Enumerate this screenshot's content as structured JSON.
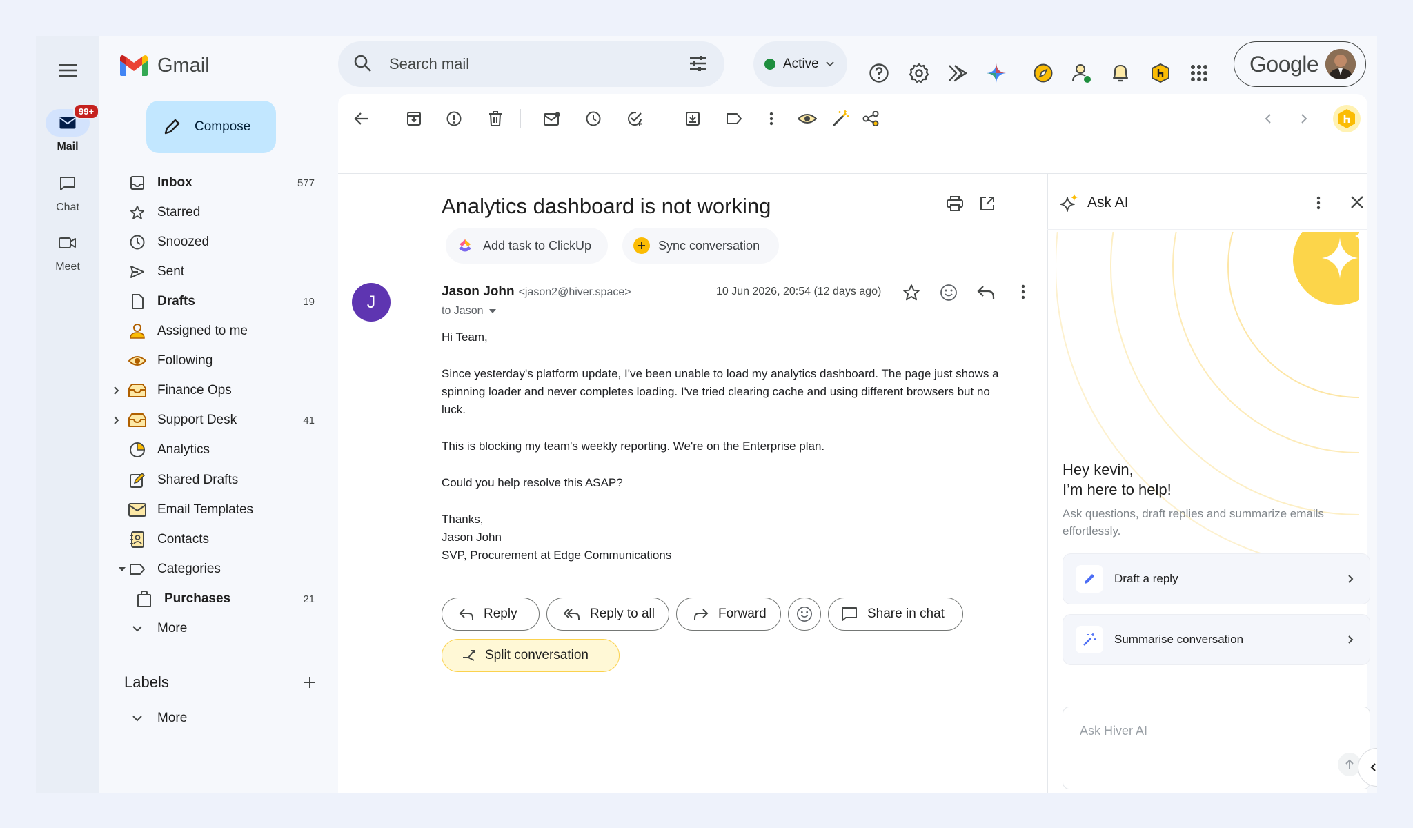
{
  "app": {
    "name": "Gmail"
  },
  "rail": {
    "items": [
      {
        "label": "Mail",
        "badge": "99+"
      },
      {
        "label": "Chat"
      },
      {
        "label": "Meet"
      }
    ]
  },
  "sidebar": {
    "compose_label": "Compose",
    "items": [
      {
        "label": "Inbox",
        "count": "577"
      },
      {
        "label": "Starred",
        "count": ""
      },
      {
        "label": "Snoozed",
        "count": ""
      },
      {
        "label": "Sent",
        "count": ""
      },
      {
        "label": "Drafts",
        "count": "19"
      },
      {
        "label": "Assigned to me",
        "count": ""
      },
      {
        "label": "Following",
        "count": ""
      },
      {
        "label": "Finance Ops",
        "count": ""
      },
      {
        "label": "Support Desk",
        "count": "41"
      },
      {
        "label": "Analytics",
        "count": ""
      },
      {
        "label": "Shared Drafts",
        "count": ""
      },
      {
        "label": "Email Templates",
        "count": ""
      },
      {
        "label": "Contacts",
        "count": ""
      },
      {
        "label": "Categories",
        "count": ""
      },
      {
        "label": "Purchases",
        "count": "21"
      },
      {
        "label": "More",
        "count": ""
      }
    ],
    "labels_heading": "Labels",
    "labels_more": "More"
  },
  "header": {
    "search_placeholder": "Search mail",
    "status_label": "Active",
    "account_brand": "Google"
  },
  "email": {
    "subject": "Analytics dashboard is not working",
    "actions": {
      "clickup": "Add task to ClickUp",
      "sync": "Sync conversation"
    },
    "sender_initial": "J",
    "sender_name": "Jason John",
    "sender_email": "<jason2@hiver.space>",
    "recipient": "to Jason",
    "date": "10 Jun 2026, 20:54 (12 days ago)",
    "body": [
      "Hi Team,",
      "Since yesterday's platform update, I've been unable to load my analytics dashboard. The page just shows a",
      "spinning loader and never completes loading. I've tried clearing cache and using different browsers but no",
      "luck.",
      "This is blocking my team's weekly reporting. We're on the Enterprise plan.",
      "Could you help resolve this ASAP?",
      "Thanks,",
      "Jason John",
      "SVP, Procurement at Edge Communications"
    ],
    "buttons": {
      "reply": "Reply",
      "reply_all": "Reply to all",
      "forward": "Forward",
      "share_chat": "Share in chat",
      "split": "Split conversation"
    }
  },
  "ai_panel": {
    "title": "Ask AI",
    "greeting_line1": "Hey kevin,",
    "greeting_line2": "I’m here to help!",
    "subtitle_line1": "Ask questions, draft replies and summarize emails",
    "subtitle_line2": "effortlessly.",
    "cards": [
      {
        "label": "Draft a reply"
      },
      {
        "label": "Summarise conversation"
      }
    ],
    "input_placeholder": "Ask Hiver AI"
  }
}
